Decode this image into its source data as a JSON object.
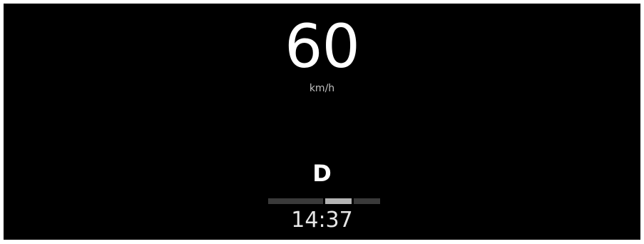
{
  "speed": {
    "value": "60",
    "unit": "km/h"
  },
  "gear": {
    "label": "D",
    "indicator": {
      "segments": 3,
      "active_index": 1
    }
  },
  "clock": {
    "time": "14:37"
  },
  "colors": {
    "background": "#000000",
    "frame": "#ffffff",
    "primary_text": "#ffffff",
    "secondary_text": "#bfbfbf",
    "indicator_inactive": "#3a3a3a",
    "indicator_active": "#b3b3b3"
  }
}
